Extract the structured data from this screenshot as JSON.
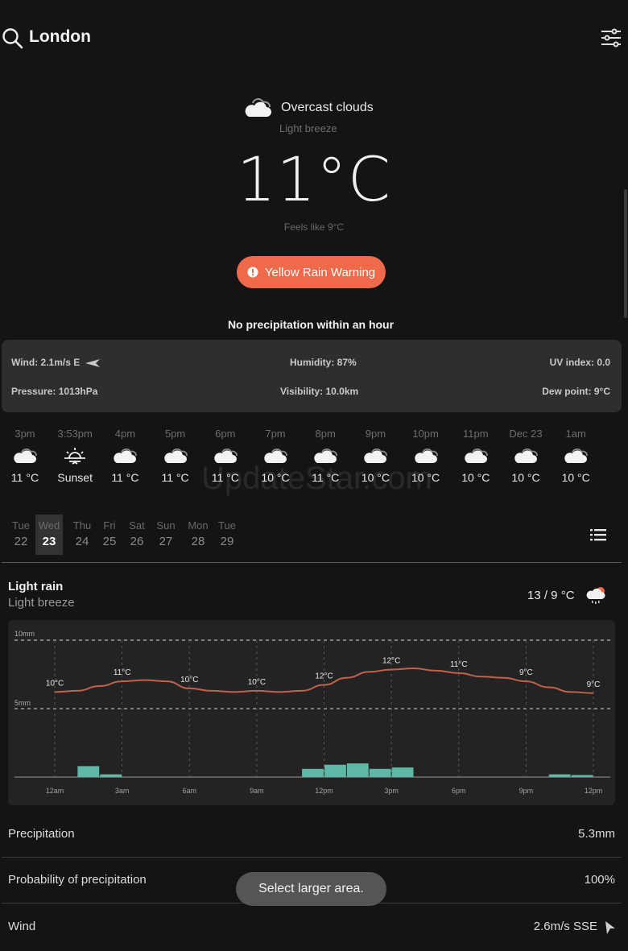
{
  "header": {
    "city": "London"
  },
  "current": {
    "condition": "Overcast clouds",
    "wind_desc": "Light breeze",
    "temperature": "11°C",
    "feels_like": "Feels like 9°C",
    "warning": "Yellow Rain Warning",
    "precip_msg": "No precipitation within an hour"
  },
  "details": {
    "wind": "Wind: 2.1m/s E",
    "humidity": "Humidity: 87%",
    "uv": "UV index: 0.0",
    "pressure": "Pressure: 1013hPa",
    "visibility": "Visibility: 10.0km",
    "dew": "Dew point: 9°C"
  },
  "hourly": [
    {
      "time": "3pm",
      "value": "11 °C",
      "icon": "cloud-icon"
    },
    {
      "time": "3:53pm",
      "value": "Sunset",
      "icon": "sunset-icon"
    },
    {
      "time": "4pm",
      "value": "11 °C",
      "icon": "cloud-icon"
    },
    {
      "time": "5pm",
      "value": "11 °C",
      "icon": "cloud-icon"
    },
    {
      "time": "6pm",
      "value": "11 °C",
      "icon": "cloud-icon"
    },
    {
      "time": "7pm",
      "value": "10 °C",
      "icon": "cloud-icon"
    },
    {
      "time": "8pm",
      "value": "11 °C",
      "icon": "cloud-icon"
    },
    {
      "time": "9pm",
      "value": "10 °C",
      "icon": "cloud-icon"
    },
    {
      "time": "10pm",
      "value": "10 °C",
      "icon": "cloud-icon"
    },
    {
      "time": "11pm",
      "value": "10 °C",
      "icon": "cloud-icon"
    },
    {
      "time": "Dec 23",
      "value": "10 °C",
      "icon": "cloud-icon"
    },
    {
      "time": "1am",
      "value": "10 °C",
      "icon": "cloud-icon"
    }
  ],
  "watermark": "UpdateStar.com",
  "days": [
    {
      "name": "Tue",
      "date": "22"
    },
    {
      "name": "Wed",
      "date": "23",
      "selected": true
    },
    {
      "name": "Thu",
      "date": "24"
    },
    {
      "name": "Fri",
      "date": "25"
    },
    {
      "name": "Sat",
      "date": "26"
    },
    {
      "name": "Sun",
      "date": "27"
    },
    {
      "name": "Mon",
      "date": "28"
    },
    {
      "name": "Tue",
      "date": "29"
    }
  ],
  "day_detail": {
    "condition": "Light rain",
    "wind_desc": "Light breeze",
    "range": "13 / 9 °C"
  },
  "chart_data": {
    "type": "line",
    "y_labels": [
      "10mm",
      "5mm"
    ],
    "x_labels": [
      "12am",
      "3am",
      "6am",
      "9am",
      "12pm",
      "3pm",
      "6pm",
      "9pm",
      "12pm"
    ],
    "temp_labels": [
      "10°C",
      "11°C",
      "10°C",
      "10°C",
      "12°C",
      "12°C",
      "11°C",
      "9°C",
      "9°C"
    ],
    "temperature": {
      "hours": [
        0,
        1,
        2,
        3,
        4,
        5,
        6,
        7,
        8,
        9,
        10,
        11,
        12,
        13,
        14,
        15,
        16,
        17,
        18,
        19,
        20,
        21,
        22,
        23,
        24
      ],
      "values": [
        10.0,
        10.1,
        10.5,
        10.9,
        11.0,
        10.9,
        10.3,
        10.1,
        10.0,
        10.1,
        10.0,
        10.1,
        10.6,
        11.2,
        11.7,
        11.9,
        12.0,
        11.8,
        11.6,
        11.3,
        11.2,
        10.9,
        10.4,
        10.0,
        9.9
      ]
    },
    "precipitation": {
      "hours": [
        1.5,
        2.5,
        11.5,
        12.5,
        13.5,
        14.5,
        15.5,
        22.5,
        23.5
      ],
      "values_mm": [
        0.8,
        0.2,
        0.6,
        0.9,
        1.0,
        0.6,
        0.7,
        0.2,
        0.15
      ]
    },
    "colors": {
      "temp_line": "#c0614a",
      "bars": "#5fb7a5"
    }
  },
  "stats": [
    {
      "label": "Precipitation",
      "value": "5.3mm"
    },
    {
      "label": "Probability of precipitation",
      "value": "100%"
    },
    {
      "label": "Wind",
      "value": "2.6m/s SSE"
    }
  ],
  "toast": "Select larger area."
}
